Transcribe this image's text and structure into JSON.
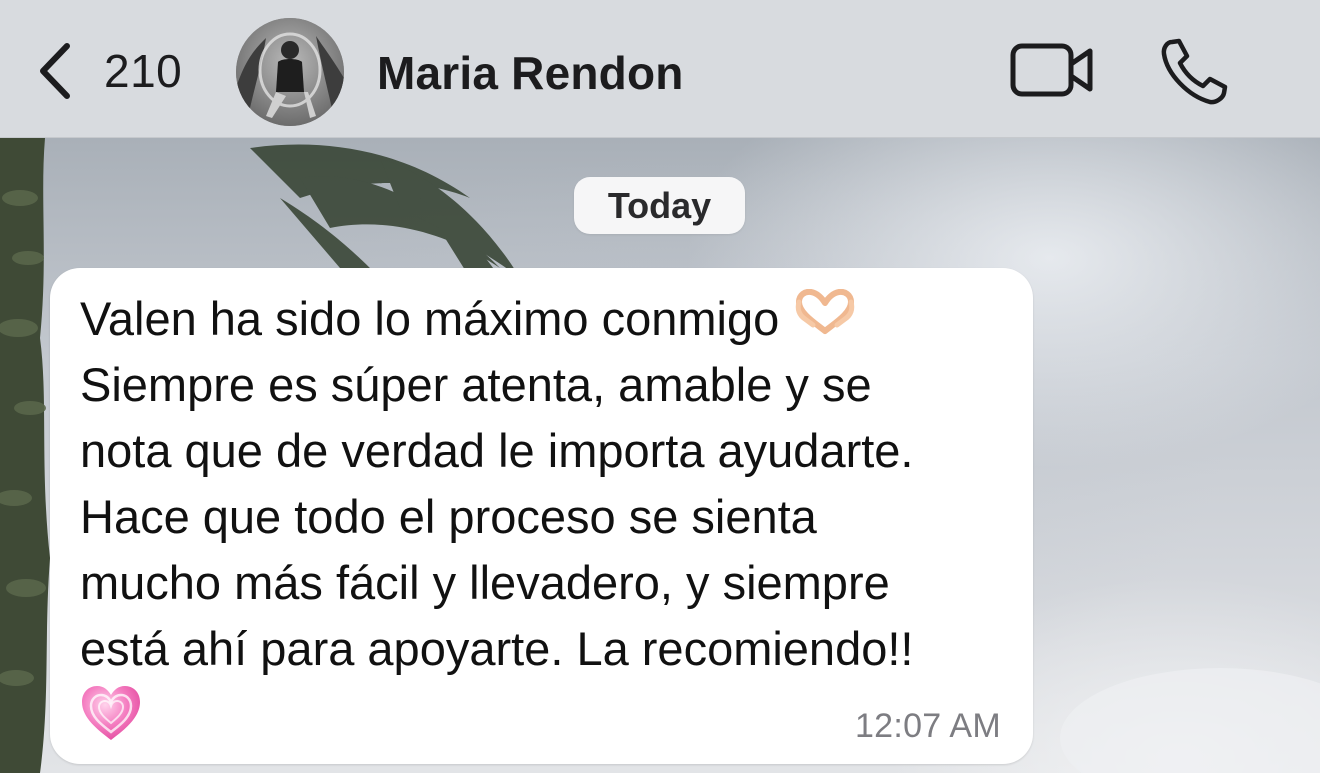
{
  "header": {
    "back_count": "210",
    "contact_name": "Maria Rendon",
    "icons": {
      "back": "chevron-left-icon",
      "video": "video-camera-icon",
      "call": "phone-icon"
    }
  },
  "chat": {
    "date_label": "Today",
    "message": {
      "lines": [
        "Valen ha sido lo máximo conmigo",
        "Siempre es súper atenta, amable y se",
        "nota que de verdad le importa ayudarte.",
        "Hace que todo el proceso se sienta",
        "mucho más fácil y llevadero, y siempre",
        "está ahí para apoyarte. La recomiendo!!"
      ],
      "emojis": [
        "heart-hands-emoji",
        "growing-heart-emoji"
      ],
      "time": "12:07 AM"
    }
  },
  "colors": {
    "header_bg": "#d8dbdf",
    "bubble_bg": "#ffffff",
    "text": "#111111",
    "timestamp": "#7d7d82",
    "accent_heart": "#f06fb8"
  }
}
